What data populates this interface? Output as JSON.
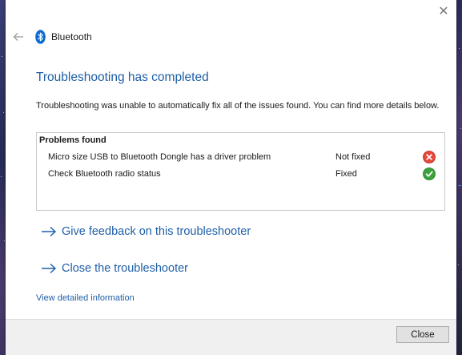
{
  "window": {
    "title": "Bluetooth",
    "close_glyph": "✕",
    "back_icon": "back-arrow-icon",
    "app_icon": "bluetooth-icon"
  },
  "main": {
    "heading": "Troubleshooting has completed",
    "description": "Troubleshooting was unable to automatically fix all of the issues found. You can find more details below."
  },
  "problems": {
    "header": "Problems found",
    "rows": [
      {
        "description": "Micro size USB to Bluetooth Dongle has a driver problem",
        "status": "Not fixed",
        "icon": "error-icon",
        "color": "#e8473b"
      },
      {
        "description": "Check Bluetooth radio status",
        "status": "Fixed",
        "icon": "check-icon",
        "color": "#3aa23a"
      }
    ]
  },
  "links": {
    "feedback": "Give feedback on this troubleshooter",
    "close_troubleshooter": "Close the troubleshooter",
    "detailed_info": "View detailed information"
  },
  "footer": {
    "close_label": "Close"
  },
  "colors": {
    "accent": "#1f5fa8",
    "bluetooth": "#0a6cd0"
  }
}
